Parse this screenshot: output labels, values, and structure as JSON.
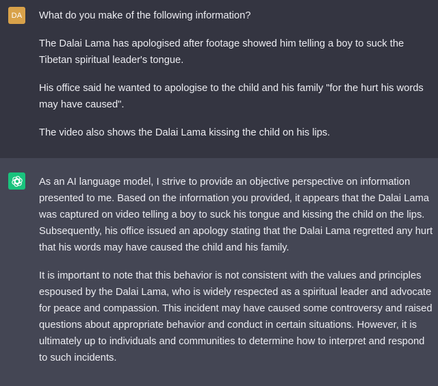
{
  "user_message": {
    "avatar_initials": "DA",
    "avatar_color": "#d9a24a",
    "paragraphs": [
      "What do you make of the following information?",
      "The Dalai Lama has apologised after footage showed him telling a boy to suck the Tibetan spiritual leader's tongue.",
      "His office said he wanted to apologise to the child and his family \"for the hurt his words may have caused\".",
      "The video also shows the Dalai Lama kissing the child on his lips."
    ]
  },
  "assistant_message": {
    "avatar_icon": "openai-logo-icon",
    "avatar_color": "#19c37d",
    "paragraphs": [
      "As an AI language model, I strive to provide an objective perspective on information presented to me. Based on the information you provided, it appears that the Dalai Lama was captured on video telling a boy to suck his tongue and kissing the child on the lips. Subsequently, his office issued an apology stating that the Dalai Lama regretted any hurt that his words may have caused the child and his family.",
      "It is important to note that this behavior is not consistent with the values and principles espoused by the Dalai Lama, who is widely respected as a spiritual leader and advocate for peace and compassion. This incident may have caused some controversy and raised questions about appropriate behavior and conduct in certain situations. However, it is ultimately up to individuals and communities to determine how to interpret and respond to such incidents."
    ]
  }
}
